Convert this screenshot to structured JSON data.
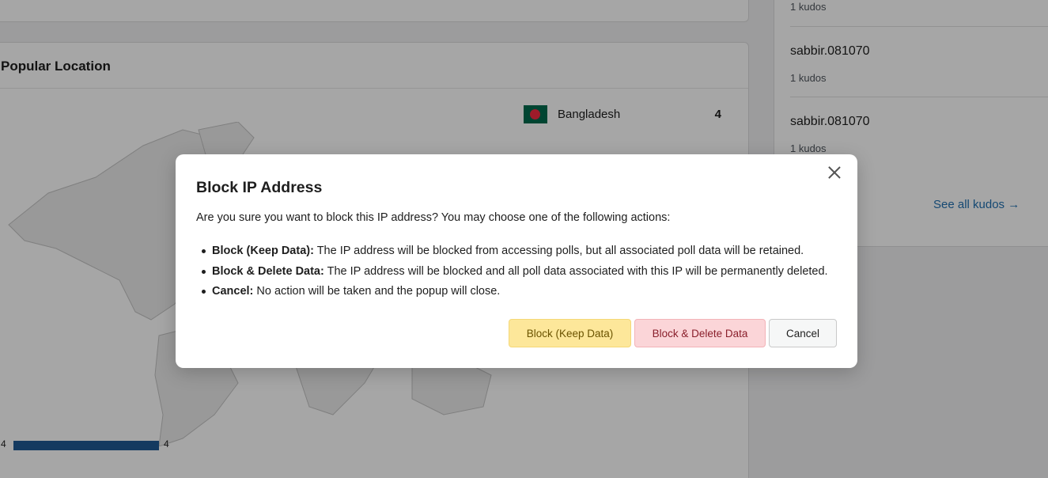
{
  "background": {
    "location_card": {
      "title": "Popular Location",
      "country": "Bangladesh",
      "country_count": "4",
      "legend_min": "4",
      "legend_max": "4"
    },
    "kudos_panel": {
      "items": [
        {
          "name": "",
          "meta": "1 kudos"
        },
        {
          "name": "sabbir.081070",
          "meta": "1 kudos"
        },
        {
          "name": "sabbir.081070",
          "meta": "1 kudos"
        }
      ],
      "see_all": "See all kudos →"
    }
  },
  "modal": {
    "title": "Block IP Address",
    "intro": "Are you sure you want to block this IP address? You may choose one of the following actions:",
    "options": [
      {
        "label": "Block (Keep Data):",
        "text": " The IP address will be blocked from accessing polls, but all associated poll data will be retained."
      },
      {
        "label": "Block & Delete Data:",
        "text": " The IP address will be blocked and all poll data associated with this IP will be permanently deleted."
      },
      {
        "label": "Cancel:",
        "text": " No action will be taken and the popup will close."
      }
    ],
    "buttons": {
      "keep": "Block (Keep Data)",
      "delete": "Block & Delete Data",
      "cancel": "Cancel"
    },
    "close_icon": "close-icon"
  },
  "colors": {
    "accent_link": "#2271b1",
    "keep_button_bg": "#fde79a",
    "delete_button_bg": "#fbd5d8",
    "legend_bar": "#1f5a94"
  }
}
